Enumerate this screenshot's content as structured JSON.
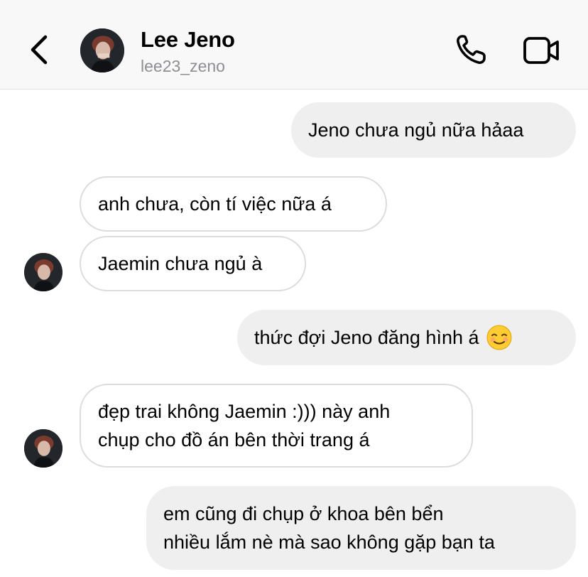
{
  "header": {
    "contact_name": "Lee Jeno",
    "contact_handle": "lee23_zeno",
    "icons": {
      "back": "chevron-left-icon",
      "call": "phone-icon",
      "video": "video-camera-icon"
    }
  },
  "messages": [
    {
      "direction": "sent",
      "lines": [
        "Jeno chưa ngủ nữa hảaa"
      ]
    },
    {
      "direction": "received",
      "lines": [
        "anh chưa, còn tí việc nữa á"
      ]
    },
    {
      "direction": "received",
      "lines": [
        "Jaemin chưa ngủ à"
      ]
    },
    {
      "direction": "sent",
      "lines": [
        "thức đợi Jeno đăng hình á"
      ],
      "emoji": "relieved-smile-emoji"
    },
    {
      "direction": "received",
      "lines": [
        "đẹp trai không Jaemin :))) này anh",
        "chụp cho đồ án bên thời trang á"
      ]
    },
    {
      "direction": "sent",
      "lines": [
        "em cũng đi chụp ở khoa bên bển",
        "nhiều lắm nè mà sao không gặp bạn ta"
      ]
    }
  ],
  "colors": {
    "sent_bubble": "#efefef",
    "received_bubble_border": "#dcdcdc",
    "header_bg": "#f8f8f8",
    "handle_text": "#8e8e93"
  }
}
